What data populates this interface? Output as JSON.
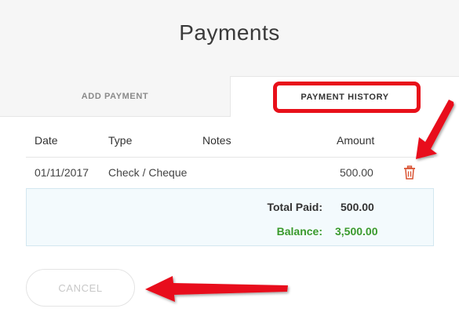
{
  "modal": {
    "title": "Payments"
  },
  "tabs": {
    "add_payment": "ADD PAYMENT",
    "payment_history": "PAYMENT HISTORY"
  },
  "table": {
    "headers": {
      "date": "Date",
      "type": "Type",
      "notes": "Notes",
      "amount": "Amount"
    },
    "rows": [
      {
        "date": "01/11/2017",
        "type": "Check / Cheque",
        "notes": "",
        "amount": "500.00",
        "action_icon": "trash-icon"
      }
    ]
  },
  "summary": {
    "total_paid_label": "Total Paid:",
    "total_paid_value": "500.00",
    "balance_label": "Balance:",
    "balance_value": "3,500.00"
  },
  "actions": {
    "cancel_label": "CANCEL"
  },
  "colors": {
    "annotation_red": "#e8101a",
    "balance_green": "#3a9a2c",
    "trash_red": "#d9502f",
    "summary_bg": "#f3fafd"
  }
}
